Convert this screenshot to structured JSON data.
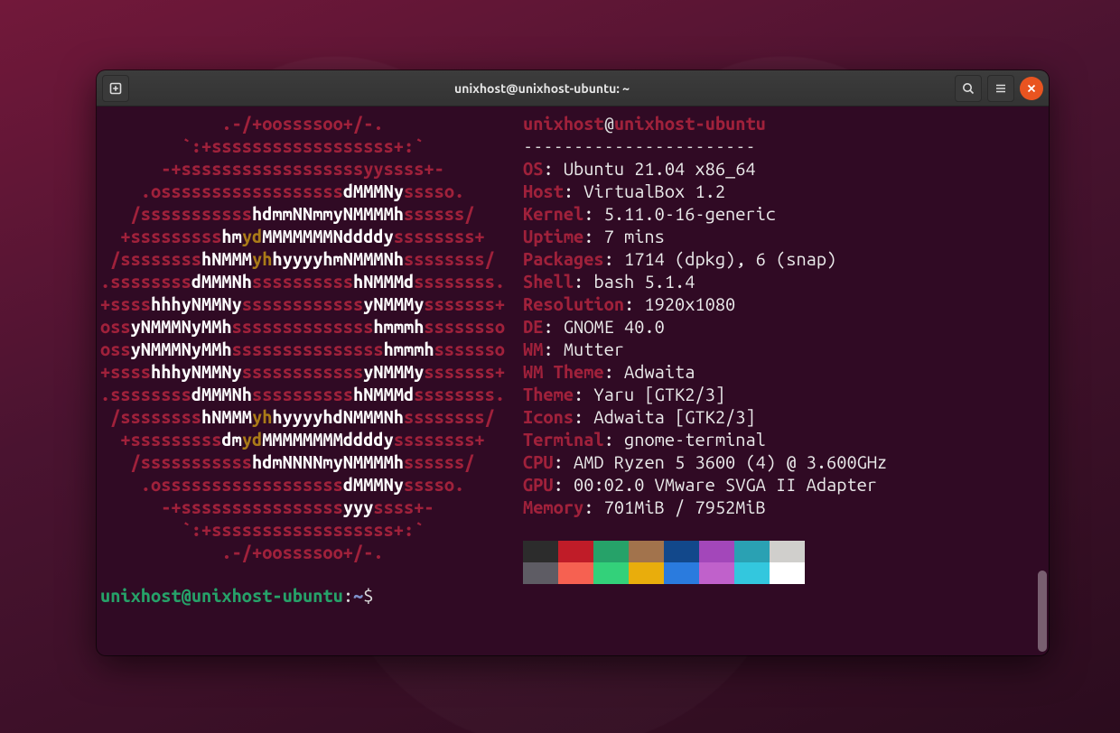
{
  "window": {
    "title": "unixhost@unixhost-ubuntu: ~"
  },
  "neofetch": {
    "user": "unixhost",
    "at": "@",
    "host": "unixhost-ubuntu",
    "separator": "-----------------------",
    "rows": [
      {
        "label": "OS",
        "value": "Ubuntu 21.04 x86_64"
      },
      {
        "label": "Host",
        "value": "VirtualBox 1.2"
      },
      {
        "label": "Kernel",
        "value": "5.11.0-16-generic"
      },
      {
        "label": "Uptime",
        "value": "7 mins"
      },
      {
        "label": "Packages",
        "value": "1714 (dpkg), 6 (snap)"
      },
      {
        "label": "Shell",
        "value": "bash 5.1.4"
      },
      {
        "label": "Resolution",
        "value": "1920x1080"
      },
      {
        "label": "DE",
        "value": "GNOME 40.0"
      },
      {
        "label": "WM",
        "value": "Mutter"
      },
      {
        "label": "WM Theme",
        "value": "Adwaita"
      },
      {
        "label": "Theme",
        "value": "Yaru [GTK2/3]"
      },
      {
        "label": "Icons",
        "value": "Adwaita [GTK2/3]"
      },
      {
        "label": "Terminal",
        "value": "gnome-terminal"
      },
      {
        "label": "CPU",
        "value": "AMD Ryzen 5 3600 (4) @ 3.600GHz"
      },
      {
        "label": "GPU",
        "value": "00:02.0 VMware SVGA II Adapter"
      },
      {
        "label": "Memory",
        "value": "701MiB / 7952MiB"
      }
    ]
  },
  "ascii": [
    [
      {
        "c": "r",
        "t": "            .-/+oossssoo+/-.            "
      }
    ],
    [
      {
        "c": "r",
        "t": "        `:+ssssssssssssssssss+:`        "
      }
    ],
    [
      {
        "c": "r",
        "t": "      -+ssssssssssssssssssyyssss+-      "
      }
    ],
    [
      {
        "c": "r",
        "t": "    .ossssssssssssssssss"
      },
      {
        "c": "w",
        "t": "dMMMNy"
      },
      {
        "c": "r",
        "t": "sssso.    "
      }
    ],
    [
      {
        "c": "r",
        "t": "   /sssssssssss"
      },
      {
        "c": "w",
        "t": "hdmmNNmmyNMMMMh"
      },
      {
        "c": "r",
        "t": "ssssss/   "
      }
    ],
    [
      {
        "c": "r",
        "t": "  +sssssssss"
      },
      {
        "c": "w",
        "t": "hm"
      },
      {
        "c": "y",
        "t": "yd"
      },
      {
        "c": "w",
        "t": "MMMMMMMNddddy"
      },
      {
        "c": "r",
        "t": "ssssssss+  "
      }
    ],
    [
      {
        "c": "r",
        "t": " /ssssssss"
      },
      {
        "c": "w",
        "t": "hNMMM"
      },
      {
        "c": "y",
        "t": "yh"
      },
      {
        "c": "w",
        "t": "hyyyyhmNMMMNh"
      },
      {
        "c": "r",
        "t": "ssssssss/ "
      }
    ],
    [
      {
        "c": "r",
        "t": ".ssssssss"
      },
      {
        "c": "w",
        "t": "dMMMNh"
      },
      {
        "c": "r",
        "t": "ssssssssss"
      },
      {
        "c": "w",
        "t": "hNMMMd"
      },
      {
        "c": "r",
        "t": "ssssssss."
      }
    ],
    [
      {
        "c": "r",
        "t": "+ssss"
      },
      {
        "c": "w",
        "t": "hhhyNMMNy"
      },
      {
        "c": "r",
        "t": "ssssssssssss"
      },
      {
        "c": "w",
        "t": "yNMMMy"
      },
      {
        "c": "r",
        "t": "sssssss+"
      }
    ],
    [
      {
        "c": "r",
        "t": "oss"
      },
      {
        "c": "w",
        "t": "yNMMMNyMMh"
      },
      {
        "c": "r",
        "t": "ssssssssssssss"
      },
      {
        "c": "w",
        "t": "hmmmh"
      },
      {
        "c": "r",
        "t": "ssssssso"
      }
    ],
    [
      {
        "c": "r",
        "t": "oss"
      },
      {
        "c": "w",
        "t": "yNMMMNyMMh"
      },
      {
        "c": "r",
        "t": "sssssssssssssss"
      },
      {
        "c": "w",
        "t": "hmmmh"
      },
      {
        "c": "r",
        "t": "sssssso"
      }
    ],
    [
      {
        "c": "r",
        "t": "+ssss"
      },
      {
        "c": "w",
        "t": "hhhyNMMNy"
      },
      {
        "c": "r",
        "t": "ssssssssssss"
      },
      {
        "c": "w",
        "t": "yNMMMy"
      },
      {
        "c": "r",
        "t": "sssssss+"
      }
    ],
    [
      {
        "c": "r",
        "t": ".ssssssss"
      },
      {
        "c": "w",
        "t": "dMMMNh"
      },
      {
        "c": "r",
        "t": "ssssssssss"
      },
      {
        "c": "w",
        "t": "hNMMMd"
      },
      {
        "c": "r",
        "t": "ssssssss."
      }
    ],
    [
      {
        "c": "r",
        "t": " /ssssssss"
      },
      {
        "c": "w",
        "t": "hNMMM"
      },
      {
        "c": "y",
        "t": "yh"
      },
      {
        "c": "w",
        "t": "hyyyyhdNMMMNh"
      },
      {
        "c": "r",
        "t": "ssssssss/ "
      }
    ],
    [
      {
        "c": "r",
        "t": "  +sssssssss"
      },
      {
        "c": "w",
        "t": "dm"
      },
      {
        "c": "y",
        "t": "yd"
      },
      {
        "c": "w",
        "t": "MMMMMMMMddddy"
      },
      {
        "c": "r",
        "t": "ssssssss+  "
      }
    ],
    [
      {
        "c": "r",
        "t": "   /sssssssssss"
      },
      {
        "c": "w",
        "t": "hdmNNNNmyNMMMMh"
      },
      {
        "c": "r",
        "t": "ssssss/   "
      }
    ],
    [
      {
        "c": "r",
        "t": "    .ossssssssssssssssss"
      },
      {
        "c": "w",
        "t": "dMMMNy"
      },
      {
        "c": "r",
        "t": "sssso.    "
      }
    ],
    [
      {
        "c": "r",
        "t": "      -+ssssssssssssssss"
      },
      {
        "c": "w",
        "t": "yyy"
      },
      {
        "c": "r",
        "t": "ssss+-      "
      }
    ],
    [
      {
        "c": "r",
        "t": "        `:+ssssssssssssssssss+:`        "
      }
    ],
    [
      {
        "c": "r",
        "t": "            .-/+oossssoo+/-.            "
      }
    ]
  ],
  "palette": {
    "row1": [
      "#2c2c2c",
      "#c01c28",
      "#26a269",
      "#a2734c",
      "#12488b",
      "#a347ba",
      "#2aa1b3",
      "#d0cfcc"
    ],
    "row2": [
      "#5e5c64",
      "#f66151",
      "#33d17a",
      "#e9ad0c",
      "#2a7bde",
      "#c061cb",
      "#33c7de",
      "#ffffff"
    ]
  },
  "prompt": {
    "user": "unixhost",
    "at": "@",
    "host": "unixhost-ubuntu",
    "sep": ":",
    "cwd": "~",
    "sym": "$"
  }
}
